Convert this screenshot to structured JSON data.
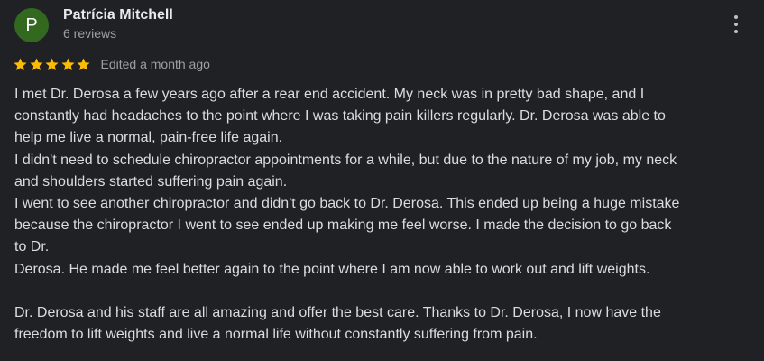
{
  "review": {
    "avatar_initial": "P",
    "avatar_color": "#33691e",
    "author_name": "Patrícia Mitchell",
    "author_meta": "6 reviews",
    "more_icon": "more-vertical-icon",
    "rating": 5,
    "rating_max": 5,
    "star_color": "#fbbc04",
    "edited_label": "Edited a month ago",
    "text_lines": [
      "I met Dr. Derosa a few years ago after a rear end accident. My neck was in pretty bad shape, and I",
      "constantly had headaches to the point where I was taking pain killers regularly. Dr. Derosa was able to",
      "help me live a normal, pain-free life again.",
      "I didn't need to schedule chiropractor appointments for a while, but due to the nature of my job, my neck",
      "and shoulders started suffering pain again.",
      "I went to see another chiropractor and didn't go back to Dr. Derosa. This ended up being a huge mistake",
      "because the chiropractor I went to see ended up making me feel worse. I made the decision to go back",
      "to Dr.",
      "Derosa. He made me feel better again to the point where I am now able to work out and lift weights.",
      "",
      "Dr. Derosa and his staff are all amazing and offer the best care. Thanks to Dr. Derosa, I now have the",
      "freedom to lift weights and live a normal life without constantly suffering from pain."
    ]
  }
}
